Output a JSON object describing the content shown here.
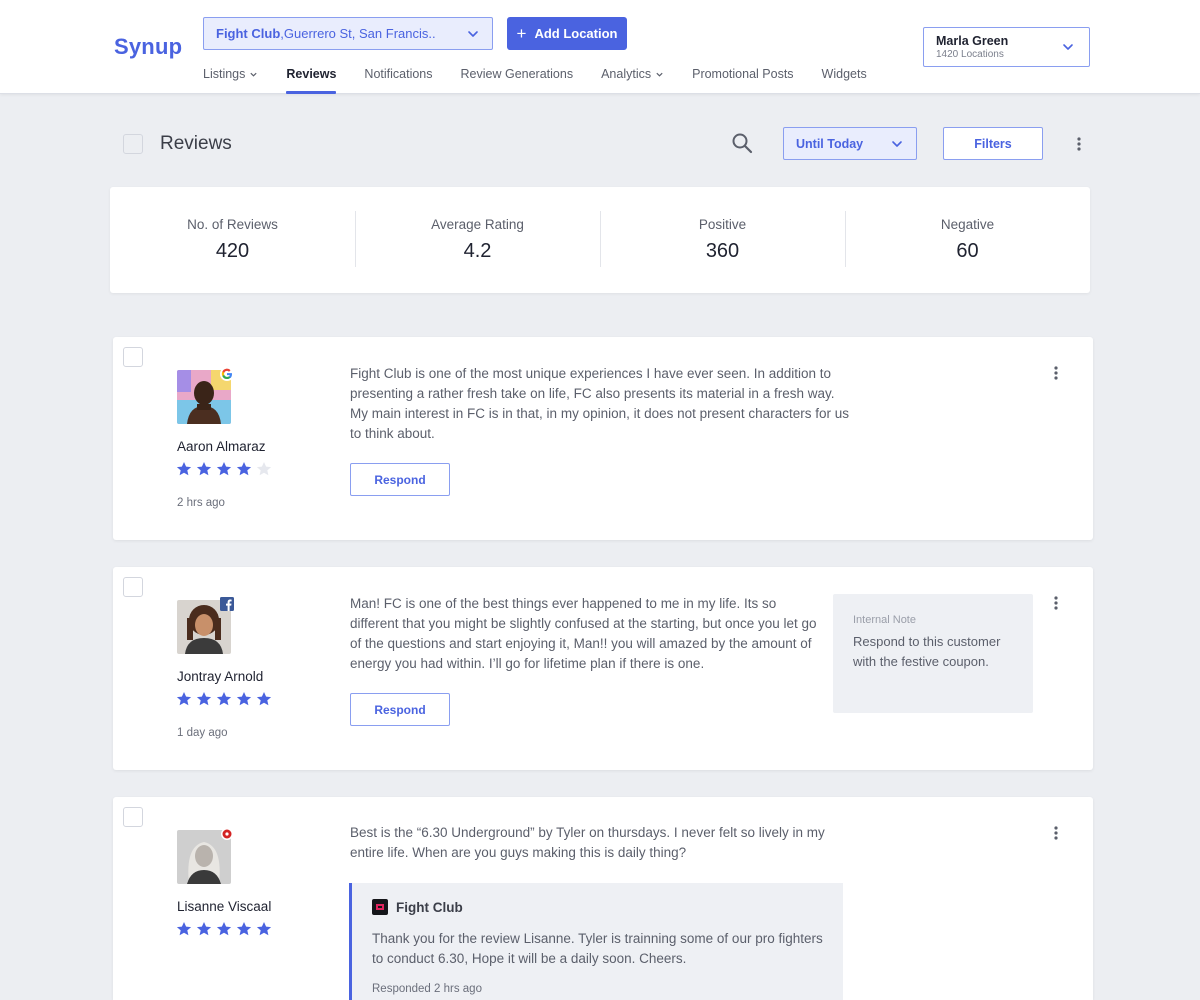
{
  "header": {
    "logo": "Synup",
    "location_name": "Fight Club",
    "location_address": ",Guerrero St, San Francis..",
    "add_location_label": "Add Location",
    "user_name": "Marla Green",
    "user_locations": "1420 Locations"
  },
  "nav": [
    {
      "label": "Listings",
      "has_dropdown": true,
      "active": false
    },
    {
      "label": "Reviews",
      "has_dropdown": false,
      "active": true
    },
    {
      "label": "Notifications",
      "has_dropdown": false,
      "active": false
    },
    {
      "label": "Review Generations",
      "has_dropdown": false,
      "active": false
    },
    {
      "label": "Analytics",
      "has_dropdown": true,
      "active": false
    },
    {
      "label": "Promotional Posts",
      "has_dropdown": false,
      "active": false
    },
    {
      "label": "Widgets",
      "has_dropdown": false,
      "active": false
    }
  ],
  "toolbar": {
    "title": "Reviews",
    "date_filter": "Until Today",
    "filters_label": "Filters"
  },
  "stats": [
    {
      "label": "No. of Reviews",
      "value": "420"
    },
    {
      "label": "Average Rating",
      "value": "4.2"
    },
    {
      "label": "Positive",
      "value": "360"
    },
    {
      "label": "Negative",
      "value": "60"
    }
  ],
  "reviews": [
    {
      "name": "Aaron Almaraz",
      "source": "google-icon",
      "rating": 4,
      "time": "2 hrs ago",
      "text": "Fight Club is one of the most unique experiences I have ever seen. In addition to presenting a rather fresh take on life, FC also presents its material in a fresh way. My main interest in FC is in that, in my opinion, it does not present characters for us to think about.",
      "respond_label": "Respond"
    },
    {
      "name": "Jontray Arnold",
      "source": "facebook-icon",
      "rating": 5,
      "time": "1 day ago",
      "text": "Man! FC is one of the best things ever happened to me in my life. Its so different that you might be slightly confused at the starting, but once you let go of the questions and start enjoying it, Man!! you will amazed by the amount of energy you had within. I’ll go for lifetime plan if there is one.",
      "respond_label": "Respond",
      "internal_note_title": "Internal Note",
      "internal_note_text": "Respond to this customer with the festive coupon."
    },
    {
      "name": "Lisanne Viscaal",
      "source": "yelp-icon",
      "rating": 5,
      "text": "Best is the “6.30 Underground” by Tyler on thursdays. I never felt so lively in my entire life. When are you guys making this is daily thing?",
      "reply_business": "Fight Club",
      "reply_text": "Thank you for the review Lisanne. Tyler is trainning some of our pro fighters to conduct 6.30, Hope it will be a daily soon. Cheers.",
      "reply_time": "Responded 2 hrs ago"
    }
  ],
  "colors": {
    "accent": "#4a63e0",
    "star_filled": "#4a63e0",
    "star_empty": "#e6e8ee",
    "background": "#eceef2"
  }
}
